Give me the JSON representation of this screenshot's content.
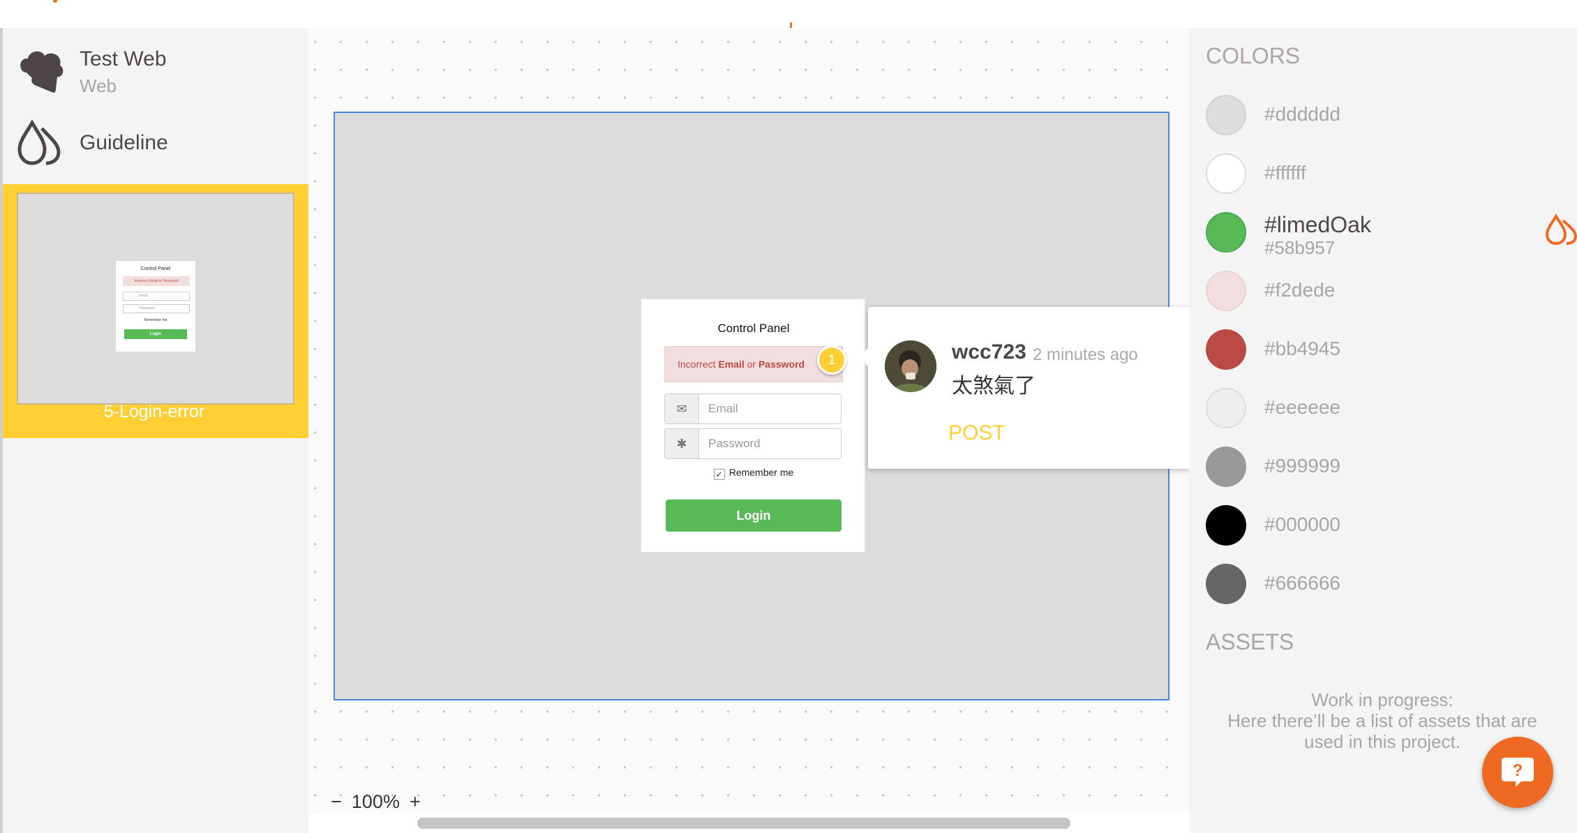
{
  "sidebar": {
    "project_title": "Test Web",
    "project_type": "Web",
    "guideline_label": "Guideline",
    "page_thumbnail_label": "5-Login-error"
  },
  "canvas": {
    "zoom_out_label": "−",
    "zoom_level": "100%",
    "zoom_in_label": "+",
    "artboard_border_color": "#4a86e0"
  },
  "login_panel": {
    "title": "Control Panel",
    "error_prefix": "Incorrect ",
    "error_email": "Email",
    "error_mid": " or ",
    "error_password": "Password",
    "email_placeholder": "Email",
    "password_placeholder": "Password",
    "remember_label": "Remember me",
    "login_label": "Login",
    "pin_number": "1"
  },
  "comment": {
    "username": "wcc723",
    "time": "2 minutes ago",
    "text": "太煞氣了",
    "post_label": "POST"
  },
  "right_panel": {
    "colors_heading": "COLORS",
    "assets_heading": "ASSETS",
    "colors": [
      {
        "name": "#dddddd",
        "swatch": "#dddddd"
      },
      {
        "name": "#ffffff",
        "swatch": "#ffffff"
      },
      {
        "name": "#limedOak",
        "hex": "#58b957",
        "swatch": "#58b957"
      },
      {
        "name": "#f2dede",
        "swatch": "#f2dede"
      },
      {
        "name": "#bb4945",
        "swatch": "#bb4945"
      },
      {
        "name": "#eeeeee",
        "swatch": "#eeeeee"
      },
      {
        "name": "#999999",
        "swatch": "#999999"
      },
      {
        "name": "#000000",
        "swatch": "#000000"
      },
      {
        "name": "#666666",
        "swatch": "#666666"
      }
    ],
    "assets_note_line1": "Work in progress:",
    "assets_note_line2": "Here there’ll be a list of assets that are",
    "assets_note_line3": "used in this project.",
    "help_label": "?"
  },
  "theme": {
    "accent_yellow": "#ffcf33",
    "accent_orange": "#ee6a23",
    "text_dark": "#4e4549",
    "text_muted": "#aaa4a6",
    "success_green": "#58b957"
  }
}
